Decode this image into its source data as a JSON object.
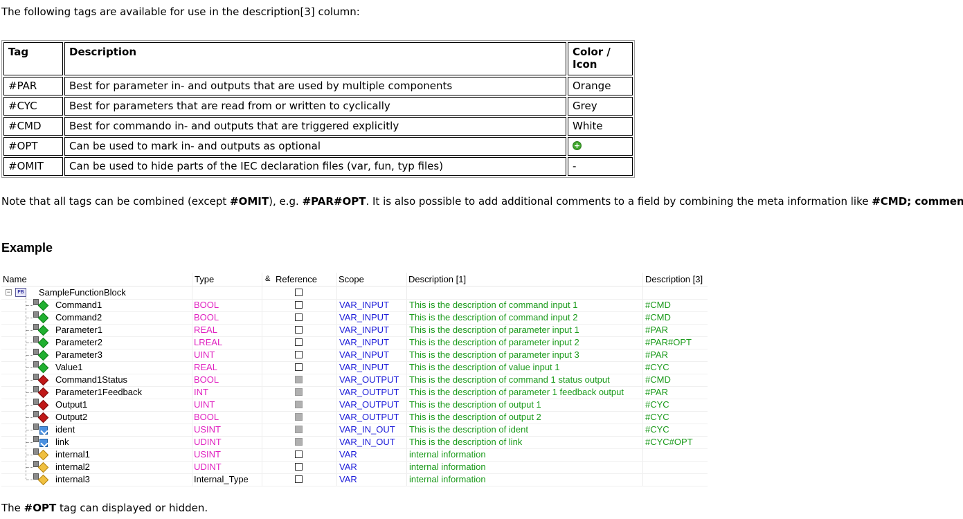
{
  "intro_text": "The following tags are available for use in the description[3] column:",
  "tags_table": {
    "headers": [
      "Tag",
      "Description",
      "Color / Icon"
    ],
    "rows": [
      {
        "tag": "#PAR",
        "description": "Best for parameter in- and outputs that are used by multiple components",
        "color": "Orange"
      },
      {
        "tag": "#CYC",
        "description": "Best for parameters that are read from or written to cyclically",
        "color": "Grey"
      },
      {
        "tag": "#CMD",
        "description": "Best for commando in- and outputs that are triggered explicitly",
        "color": "White"
      },
      {
        "tag": "#OPT",
        "description": "Can be used to mark in- and outputs as optional",
        "color": "",
        "icon": "green-plus-icon"
      },
      {
        "tag": "#OMIT",
        "description": "Can be used to hide parts of the IEC declaration files (var, fun, typ files)",
        "color": "-"
      }
    ]
  },
  "note": {
    "t1": "Note that all tags can be combined (except ",
    "b1": "#OMIT",
    "t2": "), e.g. ",
    "b2": "#PAR#OPT",
    "t3": ". It is also possible to add additional comments to a field by combining the meta information like ",
    "b3": "#CMD; comment",
    "t4": "."
  },
  "example_heading": "Example",
  "grid": {
    "headers": {
      "name": "Name",
      "type": "Type",
      "reference": "Reference",
      "reference_prefix": "&",
      "scope": "Scope",
      "desc1": "Description [1]",
      "desc3": "Description [3]"
    },
    "root": {
      "name": "SampleFunctionBlock",
      "icon_label": "FB"
    },
    "rows": [
      {
        "name": "Command1",
        "type": "BOOL",
        "ref": "empty",
        "scope": "VAR_INPUT",
        "desc1": "This is the description of command input 1",
        "desc3": "#CMD",
        "icon": "input-icon"
      },
      {
        "name": "Command2",
        "type": "BOOL",
        "ref": "empty",
        "scope": "VAR_INPUT",
        "desc1": "This is the description of command input 2",
        "desc3": "#CMD",
        "icon": "input-icon"
      },
      {
        "name": "Parameter1",
        "type": "REAL",
        "ref": "empty",
        "scope": "VAR_INPUT",
        "desc1": "This is the description of parameter input 1",
        "desc3": "#PAR",
        "icon": "input-icon"
      },
      {
        "name": "Parameter2",
        "type": "LREAL",
        "ref": "empty",
        "scope": "VAR_INPUT",
        "desc1": "This is the description of parameter input 2",
        "desc3": "#PAR#OPT",
        "icon": "input-icon"
      },
      {
        "name": "Parameter3",
        "type": "UINT",
        "ref": "empty",
        "scope": "VAR_INPUT",
        "desc1": "This is the description of parameter input 3",
        "desc3": "#PAR",
        "icon": "input-icon"
      },
      {
        "name": "Value1",
        "type": "REAL",
        "ref": "empty",
        "scope": "VAR_INPUT",
        "desc1": "This is the description of value input 1",
        "desc3": "#CYC",
        "icon": "input-icon"
      },
      {
        "name": "Command1Status",
        "type": "BOOL",
        "ref": "grey",
        "scope": "VAR_OUTPUT",
        "desc1": "This is the description of command 1 status output",
        "desc3": "#CMD",
        "icon": "output-icon"
      },
      {
        "name": "Parameter1Feedback",
        "type": "INT",
        "ref": "grey",
        "scope": "VAR_OUTPUT",
        "desc1": "This is the description of parameter 1 feedback output",
        "desc3": "#PAR",
        "icon": "output-icon"
      },
      {
        "name": "Output1",
        "type": "UINT",
        "ref": "grey",
        "scope": "VAR_OUTPUT",
        "desc1": "This is the description of output 1",
        "desc3": "#CYC",
        "icon": "output-icon"
      },
      {
        "name": "Output2",
        "type": "BOOL",
        "ref": "grey",
        "scope": "VAR_OUTPUT",
        "desc1": "This is the description of output 2",
        "desc3": "#CYC",
        "icon": "output-icon"
      },
      {
        "name": "ident",
        "type": "USINT",
        "ref": "grey",
        "scope": "VAR_IN_OUT",
        "desc1": "This is the description of ident",
        "desc3": "#CYC",
        "icon": "inout-icon"
      },
      {
        "name": "link",
        "type": "UDINT",
        "ref": "grey",
        "scope": "VAR_IN_OUT",
        "desc1": "This is the description of link",
        "desc3": "#CYC#OPT",
        "icon": "inout-icon"
      },
      {
        "name": "internal1",
        "type": "USINT",
        "ref": "empty",
        "scope": "VAR",
        "desc1": "internal information",
        "desc3": "",
        "icon": "var-icon"
      },
      {
        "name": "internal2",
        "type": "UDINT",
        "ref": "empty",
        "scope": "VAR",
        "desc1": "internal information",
        "desc3": "",
        "icon": "var-icon"
      },
      {
        "name": "internal3",
        "type": "Internal_Type",
        "ref": "empty",
        "scope": "VAR",
        "desc1": "internal information",
        "desc3": "",
        "icon": "var-icon",
        "type_color": "black"
      }
    ]
  },
  "outro": {
    "t1": "The ",
    "b1": "#OPT",
    "t2": " tag can displayed or hidden."
  },
  "colors": {
    "type_text": "#e020c0",
    "scope_text": "#1a1ad8",
    "description_text": "#1a9a1a"
  }
}
